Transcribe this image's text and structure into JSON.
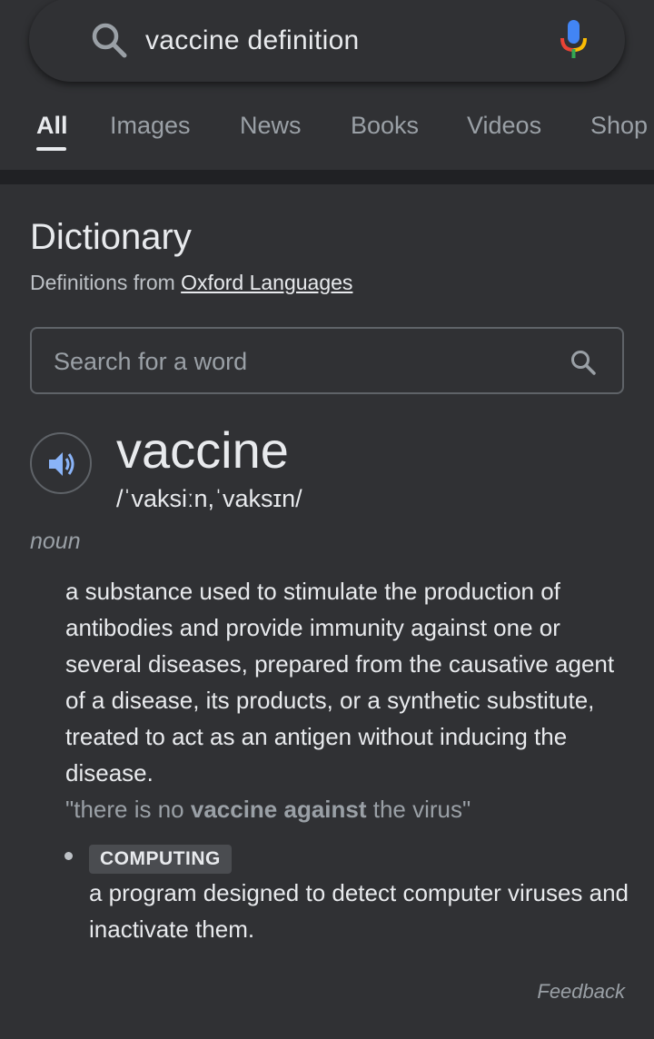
{
  "search": {
    "query": "vaccine definition",
    "icons": {
      "search": "search-icon",
      "voice": "mic-icon"
    }
  },
  "tabs": [
    {
      "label": "All",
      "active": true
    },
    {
      "label": "Images",
      "active": false
    },
    {
      "label": "News",
      "active": false
    },
    {
      "label": "Books",
      "active": false
    },
    {
      "label": "Videos",
      "active": false
    },
    {
      "label": "Shop",
      "active": false
    }
  ],
  "dictionary": {
    "title": "Dictionary",
    "source_prefix": "Definitions from ",
    "source_link": "Oxford Languages",
    "word_search_placeholder": "Search for a word",
    "headword": "vaccine",
    "phonetic": "/ˈvaksiːn,ˈvaksɪn/",
    "part_of_speech": "noun",
    "definition_1": "a substance used to stimulate the production of antibodies and provide immunity against one or several diseases, prepared from the causative agent of a disease, its products, or a synthetic substitute, treated to act as an antigen without inducing the disease.",
    "example": {
      "before": "\"there is no ",
      "bold": "vaccine against",
      "after": " the virus\""
    },
    "sense_2": {
      "label": "COMPUTING",
      "definition": "a program designed to detect computer viruses and inactivate them."
    },
    "feedback": "Feedback"
  },
  "colors": {
    "background": "#303134",
    "divider": "#202124",
    "text_primary": "#e8eaed",
    "text_secondary": "#9aa0a6",
    "speaker_blue": "#8ab4f8"
  }
}
